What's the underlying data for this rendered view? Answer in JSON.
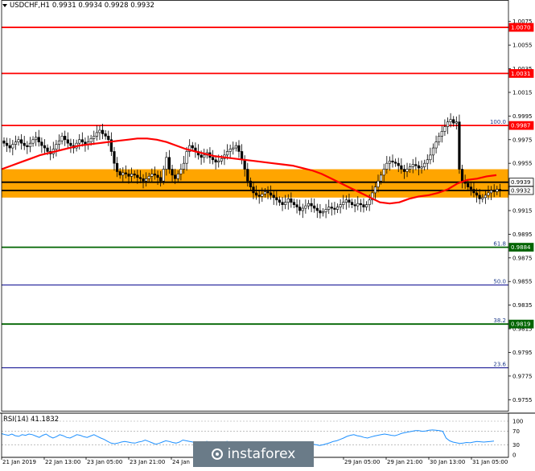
{
  "header": {
    "symbol": "USDCHF,H1",
    "ohlc": "0.9931 0.9934 0.9928 0.9932"
  },
  "rsi": {
    "label": "RSI(14) 41.1832",
    "levels": [
      "100",
      "70",
      "30",
      "0"
    ],
    "values": [
      63,
      60,
      58,
      62,
      57,
      55,
      60,
      58,
      62,
      60,
      56,
      52,
      58,
      62,
      55,
      50,
      54,
      60,
      57,
      52,
      50,
      55,
      60,
      58,
      54,
      52,
      56,
      60,
      55,
      50,
      46,
      40,
      35,
      33,
      35,
      38,
      40,
      38,
      36,
      35,
      38,
      40,
      44,
      40,
      36,
      32,
      34,
      38,
      42,
      40,
      37,
      35,
      38,
      44,
      42,
      40,
      38,
      36,
      35,
      37,
      40,
      38,
      36,
      34,
      35,
      38,
      40,
      36,
      34,
      33,
      32,
      34,
      36,
      33,
      30,
      28,
      26,
      27,
      30,
      32,
      30,
      28,
      27,
      26,
      28,
      30,
      27,
      25,
      24,
      26,
      29,
      32,
      30,
      28,
      30,
      33,
      36,
      40,
      42,
      46,
      50,
      55,
      58,
      60,
      57,
      55,
      52,
      50,
      53,
      56,
      58,
      60,
      62,
      60,
      58,
      57,
      60,
      64,
      66,
      68,
      70,
      72,
      72,
      70,
      71,
      73,
      74,
      73,
      72,
      70,
      50,
      42,
      38,
      36,
      34,
      35,
      37,
      36,
      38,
      40,
      39,
      38,
      39,
      40,
      41
    ]
  },
  "watermark": "instaforex",
  "colors": {
    "candle": "#000000",
    "ma": "#ff0000",
    "band": "#ffa500",
    "hline_red": "#ff0000",
    "hline_green": "#006400",
    "hline_blue": "#00008b",
    "price_black": "#000000",
    "rsi": "#1e90ff"
  },
  "chart_data": {
    "type": "candlestick",
    "y_range": [
      0.9745,
      1.0085
    ],
    "y_ticks": [
      "1.0075",
      "1.0055",
      "1.0035",
      "1.0015",
      "0.9995",
      "0.9975",
      "0.9955",
      "0.9935",
      "0.9915",
      "0.9895",
      "0.9875",
      "0.9855",
      "0.9835",
      "0.9815",
      "0.9795",
      "0.9775",
      "0.9755"
    ],
    "x_ticks": [
      "21 Jan 2019",
      "22 Jan 13:00",
      "23 Jan 05:00",
      "23 Jan 21:00",
      "24 Jan",
      "29 Jan 05:00",
      "29 Jan 21:00",
      "30 Jan 13:00",
      "31 Jan 05:00"
    ],
    "levels": [
      {
        "price": 1.007,
        "label": "1.0070",
        "color": "red"
      },
      {
        "price": 1.0031,
        "label": "1.0031",
        "color": "red"
      },
      {
        "price": 0.9987,
        "label": "0.9987",
        "color": "red",
        "fib": "100.0"
      },
      {
        "price": 0.9939,
        "label": "0.9939",
        "color": "black"
      },
      {
        "price": 0.9932,
        "label": "0.9932",
        "color": "black"
      },
      {
        "price": 0.9884,
        "label": "0.9884",
        "color": "green",
        "fib": "61.8"
      },
      {
        "price": 0.9852,
        "label": "",
        "color": "blue",
        "fib": "50.0"
      },
      {
        "price": 0.9819,
        "label": "0.9819",
        "color": "green",
        "fib": "38.2"
      },
      {
        "price": 0.9782,
        "label": "",
        "color": "blue",
        "fib": "23.6"
      }
    ],
    "band": [
      0.9926,
      0.995
    ],
    "closes": [
      0.9972,
      0.997,
      0.9968,
      0.9971,
      0.9973,
      0.9975,
      0.9972,
      0.997,
      0.9969,
      0.9972,
      0.9975,
      0.9977,
      0.9973,
      0.997,
      0.9968,
      0.9965,
      0.9963,
      0.9967,
      0.9971,
      0.9974,
      0.9978,
      0.9975,
      0.9972,
      0.997,
      0.9968,
      0.9972,
      0.9975,
      0.9973,
      0.9971,
      0.9973,
      0.9976,
      0.9978,
      0.9981,
      0.9983,
      0.998,
      0.9978,
      0.9975,
      0.9965,
      0.9955,
      0.9948,
      0.9945,
      0.9947,
      0.9946,
      0.9944,
      0.9946,
      0.9945,
      0.9943,
      0.9942,
      0.994,
      0.9942,
      0.9944,
      0.9946,
      0.9945,
      0.9943,
      0.994,
      0.995,
      0.996,
      0.995,
      0.9945,
      0.9942,
      0.9946,
      0.995,
      0.9955,
      0.9965,
      0.997,
      0.9968,
      0.9965,
      0.9962,
      0.996,
      0.9962,
      0.9964,
      0.996,
      0.9958,
      0.9956,
      0.9957,
      0.9959,
      0.9962,
      0.9965,
      0.9967,
      0.9968,
      0.997,
      0.9965,
      0.9958,
      0.995,
      0.994,
      0.9935,
      0.993,
      0.9928,
      0.9927,
      0.9929,
      0.9931,
      0.993,
      0.9928,
      0.9926,
      0.9924,
      0.9922,
      0.992,
      0.9922,
      0.9925,
      0.9922,
      0.992,
      0.9918,
      0.9915,
      0.9917,
      0.9919,
      0.9921,
      0.9919,
      0.9917,
      0.9915,
      0.9913,
      0.9914,
      0.9916,
      0.9918,
      0.9917,
      0.9916,
      0.9918,
      0.992,
      0.9922,
      0.9924,
      0.9922,
      0.992,
      0.9919,
      0.9921,
      0.992,
      0.9918,
      0.992,
      0.9924,
      0.993,
      0.9935,
      0.994,
      0.9945,
      0.995,
      0.9955,
      0.9957,
      0.9956,
      0.9955,
      0.9953,
      0.995,
      0.9948,
      0.995,
      0.9952,
      0.9954,
      0.9953,
      0.9951,
      0.9952,
      0.9955,
      0.9958,
      0.9962,
      0.9968,
      0.9973,
      0.9978,
      0.9982,
      0.9986,
      0.999,
      0.9992,
      0.9989,
      0.999,
      0.995,
      0.994,
      0.9938,
      0.9935,
      0.9933,
      0.993,
      0.9928,
      0.9925,
      0.9926,
      0.9928,
      0.993,
      0.9932,
      0.9931,
      0.9933,
      0.9932
    ],
    "ma": [
      0.995,
      0.9953,
      0.9956,
      0.9959,
      0.9962,
      0.9964,
      0.9966,
      0.9968,
      0.997,
      0.9971,
      0.9972,
      0.9973,
      0.9974,
      0.9975,
      0.9976,
      0.9976,
      0.9975,
      0.9973,
      0.997,
      0.9967,
      0.9965,
      0.9963,
      0.9961,
      0.996,
      0.9959,
      0.9958,
      0.9957,
      0.9956,
      0.9955,
      0.9954,
      0.9953,
      0.9951,
      0.9949,
      0.9946,
      0.9942,
      0.9938,
      0.9934,
      0.993,
      0.9926,
      0.9922,
      0.9921,
      0.9922,
      0.9925,
      0.9927,
      0.9928,
      0.993,
      0.9933,
      0.9938,
      0.9941,
      0.9942,
      0.9944,
      0.9945
    ]
  }
}
